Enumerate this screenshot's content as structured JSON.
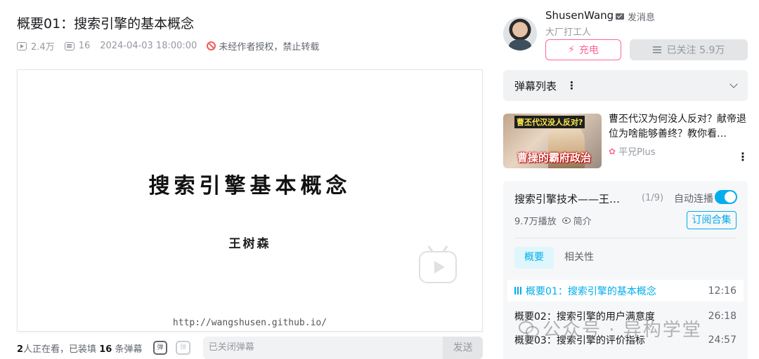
{
  "video": {
    "title": "概要01：搜索引擎的基本概念",
    "views": "2.4万",
    "danmaku_count": "16",
    "datetime": "2024-04-03 18:00:00",
    "copyright": "未经作者授权，禁止转载"
  },
  "slide": {
    "title": "搜索引擎基本概念",
    "author": "王树森",
    "url": "http://wangshusen.github.io/"
  },
  "danmaku_bar": {
    "watching_count": "2",
    "watching_text": "人正在看，已装填",
    "loaded_count": "16",
    "loaded_suffix": "条弹幕",
    "toggle_icon_label": "弹",
    "input_placeholder": "已关闭弹幕",
    "send_label": "发送"
  },
  "uploader": {
    "name": "ShusenWang",
    "message_label": "发消息",
    "description": "大厂打工人",
    "charge_label": "充电",
    "follow_label": "已关注 5.9万"
  },
  "danmaku_list": {
    "label": "弹幕列表",
    "dots": "⋮"
  },
  "recommend": {
    "thumb_caption_top": "曹丕代汉没人反对?",
    "thumb_caption_bottom": "曹操的霸府政治",
    "title": "曹丕代汉为何没人反对？献帝退位为啥能够善终？教你看…",
    "author": "平兄Plus",
    "more": "⋮"
  },
  "collection": {
    "title": "搜索引擎技术——王…",
    "count": "(1/9)",
    "autoplay_label": "自动连播",
    "plays": "9.7万播放",
    "intro_label": "简介",
    "subscribe_label": "订阅合集",
    "tabs": [
      {
        "label": "概要"
      },
      {
        "label": "相关性"
      }
    ],
    "episodes": [
      {
        "title": "概要01：搜索引擎的基本概念",
        "duration": "12:16"
      },
      {
        "title": "概要02：搜索引擎的用户满意度",
        "duration": "26:18"
      },
      {
        "title": "概要03：搜索引擎的评价指标",
        "duration": "24:57"
      }
    ]
  },
  "watermark": "公众号 · 异构学堂",
  "colors": {
    "accent": "#00aeec",
    "charge": "#ff6699",
    "muted": "#9499a0"
  }
}
